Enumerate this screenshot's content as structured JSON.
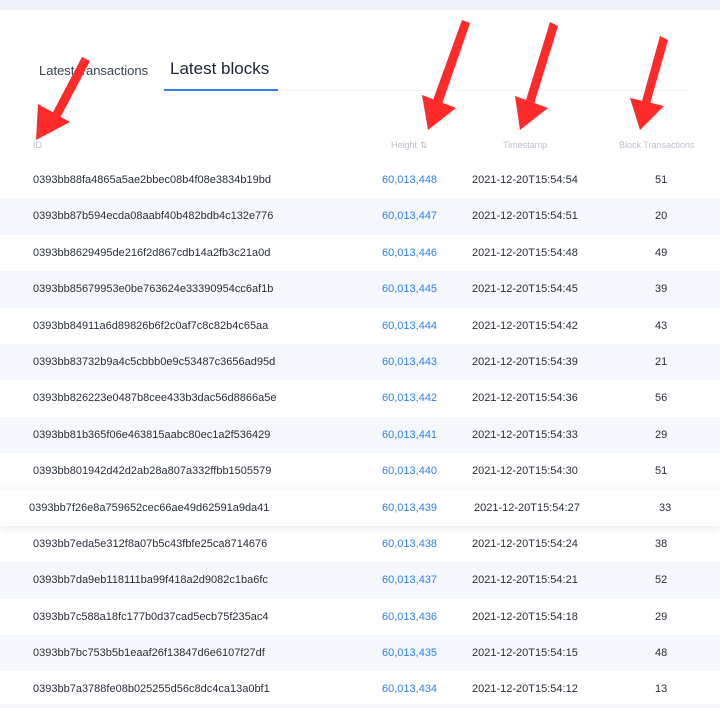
{
  "tabs": [
    {
      "label": "Latest transactions",
      "active": false
    },
    {
      "label": "Latest blocks",
      "active": true
    }
  ],
  "table": {
    "headers": {
      "id": "ID",
      "height": "Height",
      "timestamp": "Timestamp",
      "block_transactions": "Block Transactions"
    },
    "rows": [
      {
        "id": "0393bb88fa4865a5ae2bbec08b4f08e3834b19bd",
        "height": "60,013,448",
        "timestamp": "2021-12-20T15:54:54",
        "tx": "51"
      },
      {
        "id": "0393bb87b594ecda08aabf40b482bdb4c132e776",
        "height": "60,013,447",
        "timestamp": "2021-12-20T15:54:51",
        "tx": "20"
      },
      {
        "id": "0393bb8629495de216f2d867cdb14a2fb3c21a0d",
        "height": "60,013,446",
        "timestamp": "2021-12-20T15:54:48",
        "tx": "49"
      },
      {
        "id": "0393bb85679953e0be763624e33390954cc6af1b",
        "height": "60,013,445",
        "timestamp": "2021-12-20T15:54:45",
        "tx": "39"
      },
      {
        "id": "0393bb84911a6d89826b6f2c0af7c8c82b4c65aa",
        "height": "60,013,444",
        "timestamp": "2021-12-20T15:54:42",
        "tx": "43"
      },
      {
        "id": "0393bb83732b9a4c5cbbb0e9c53487c3656ad95d",
        "height": "60,013,443",
        "timestamp": "2021-12-20T15:54:39",
        "tx": "21"
      },
      {
        "id": "0393bb826223e0487b8cee433b3dac56d8866a5e",
        "height": "60,013,442",
        "timestamp": "2021-12-20T15:54:36",
        "tx": "56"
      },
      {
        "id": "0393bb81b365f06e463815aabc80ec1a2f536429",
        "height": "60,013,441",
        "timestamp": "2021-12-20T15:54:33",
        "tx": "29"
      },
      {
        "id": "0393bb801942d42d2ab28a807a332ffbb1505579",
        "height": "60,013,440",
        "timestamp": "2021-12-20T15:54:30",
        "tx": "51"
      },
      {
        "id": "0393bb7f26e8a759652cec66ae49d62591a9da41",
        "height": "60,013,439",
        "timestamp": "2021-12-20T15:54:27",
        "tx": "33"
      },
      {
        "id": "0393bb7eda5e312f8a07b5c43fbfe25ca8714676",
        "height": "60,013,438",
        "timestamp": "2021-12-20T15:54:24",
        "tx": "38"
      },
      {
        "id": "0393bb7da9eb118111ba99f418a2d9082c1ba6fc",
        "height": "60,013,437",
        "timestamp": "2021-12-20T15:54:21",
        "tx": "52"
      },
      {
        "id": "0393bb7c588a18fc177b0d37cad5ecb75f235ac4",
        "height": "60,013,436",
        "timestamp": "2021-12-20T15:54:18",
        "tx": "29"
      },
      {
        "id": "0393bb7bc753b5b1eaaf26f13847d6e6107f27df",
        "height": "60,013,435",
        "timestamp": "2021-12-20T15:54:15",
        "tx": "48"
      },
      {
        "id": "0393bb7a3788fe08b025255d56c8dc4ca13a0bf1",
        "height": "60,013,434",
        "timestamp": "2021-12-20T15:54:12",
        "tx": "13"
      }
    ]
  },
  "colors": {
    "accent": "#2f80ed",
    "annotation": "#ff2a2a"
  }
}
